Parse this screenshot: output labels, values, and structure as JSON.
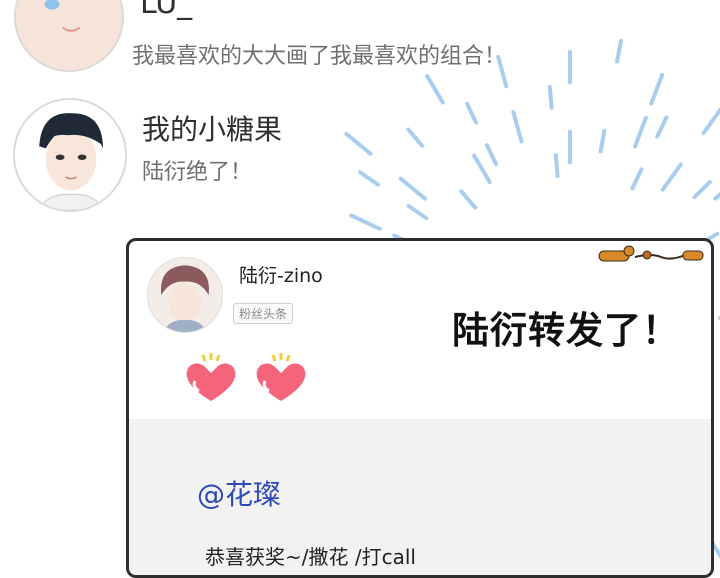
{
  "comments": [
    {
      "username": "LU_",
      "message": "我最喜欢的大大画了我最喜欢的组合！"
    },
    {
      "username": "我的小糖果",
      "message": "陆衍绝了！"
    }
  ],
  "repost": {
    "username": "陆衍-zino",
    "badge": "粉丝头条",
    "mention": "@花璨",
    "content": "恭喜获奖~/撒花  /打call"
  },
  "caption": "陆衍转发了！",
  "colors": {
    "mention": "#2d49b5",
    "burst": "#a9cdee"
  },
  "icons": [
    "heart-icon",
    "sparkle-icon",
    "sausage-dog-icon"
  ]
}
